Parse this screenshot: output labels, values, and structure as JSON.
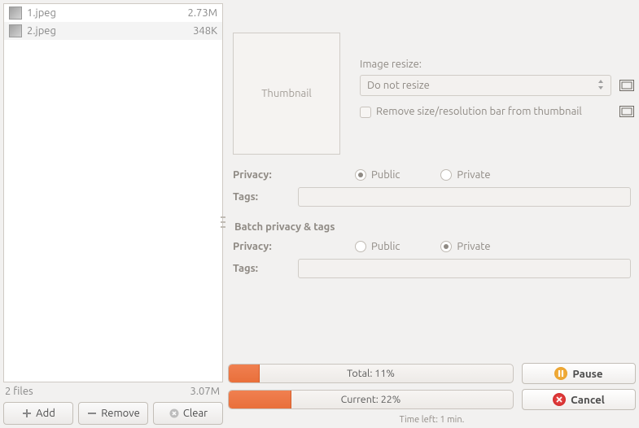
{
  "files": [
    {
      "name": "1.jpeg",
      "size": "2.73M"
    },
    {
      "name": "2.jpeg",
      "size": "348K"
    }
  ],
  "totals": {
    "count": "2 files",
    "size": "3.07M"
  },
  "buttons": {
    "add": "Add",
    "remove": "Remove",
    "clear": "Clear"
  },
  "thumbnail_placeholder": "Thumbnail",
  "resize": {
    "label": "Image resize:",
    "selected": "Do not resize",
    "remove_bar": "Remove size/resolution bar from thumbnail"
  },
  "single": {
    "privacy_label": "Privacy:",
    "public": "Public",
    "private": "Private",
    "privacy_value": "public",
    "tags_label": "Tags:",
    "tags_value": ""
  },
  "batch": {
    "title": "Batch privacy & tags",
    "privacy_label": "Privacy:",
    "public": "Public",
    "private": "Private",
    "privacy_value": "private",
    "tags_label": "Tags:",
    "tags_value": ""
  },
  "progress": {
    "total_label": "Total: 11%",
    "total_pct": 11,
    "current_label": "Current: 22%",
    "current_pct": 22,
    "time_left": "Time left: 1 min."
  },
  "action": {
    "pause": "Pause",
    "cancel": "Cancel"
  },
  "colors": {
    "accent": "#e96f3b"
  }
}
